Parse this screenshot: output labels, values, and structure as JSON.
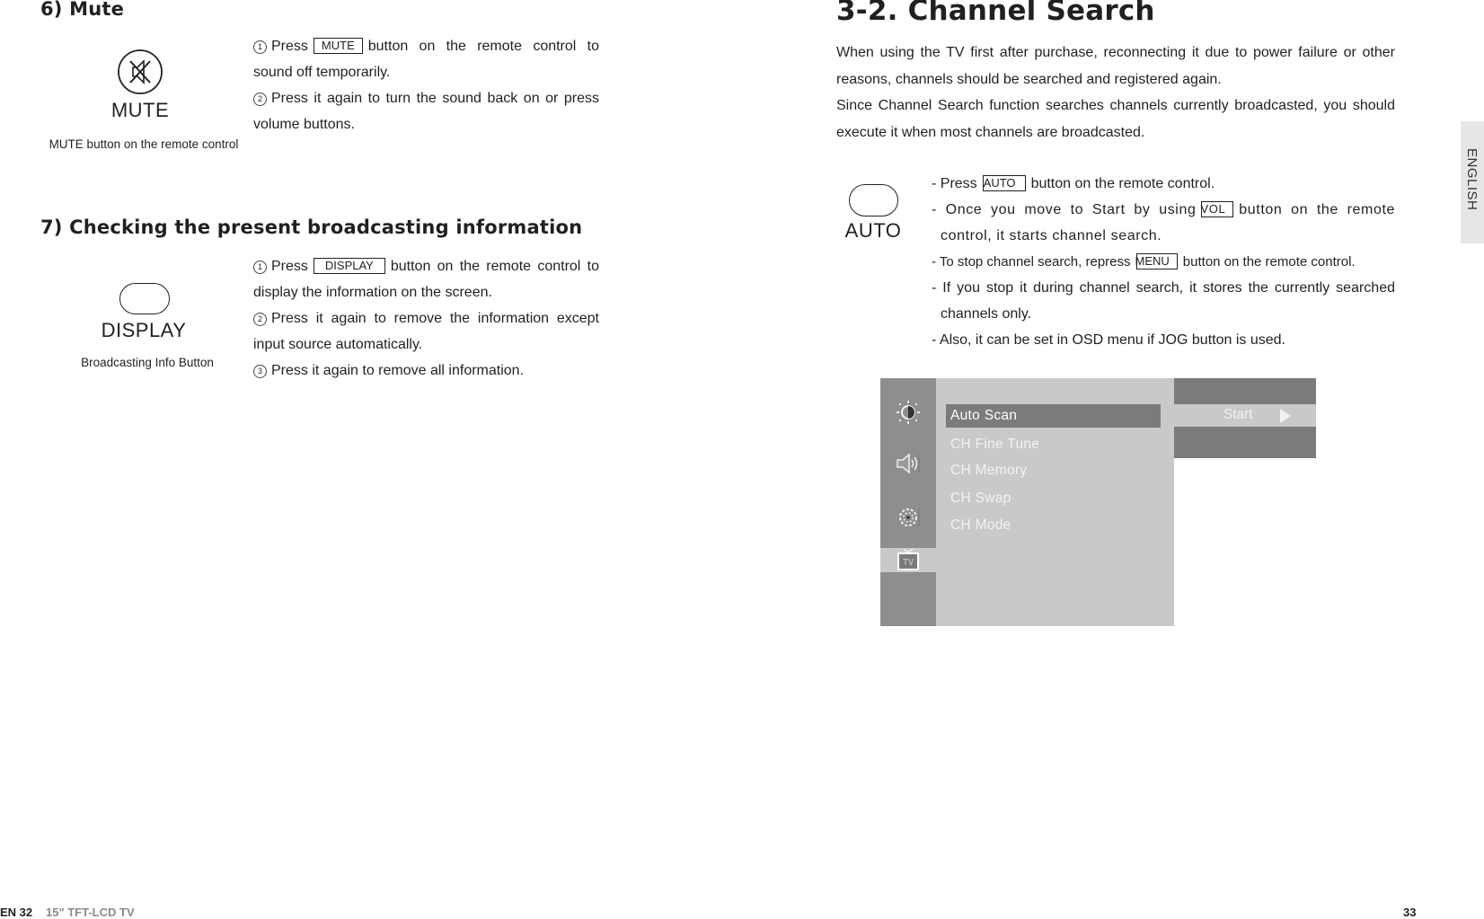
{
  "left_page": {
    "mute_section": {
      "heading": "6) Mute",
      "button_label": "MUTE",
      "caption": "MUTE button on the remote control",
      "steps": [
        {
          "num": "1",
          "pre": "Press",
          "key": "MUTE",
          "post": "button on the remote control to sound off temporarily."
        },
        {
          "num": "2",
          "text": "Press it again to turn the sound back on or press volume buttons."
        }
      ]
    },
    "display_section": {
      "heading": "7) Checking the present broadcasting information",
      "button_label": "DISPLAY",
      "caption": "Broadcasting Info Button",
      "steps": [
        {
          "num": "1",
          "pre": "Press",
          "key": "DISPLAY",
          "post": "button on the remote control to display the information on the screen."
        },
        {
          "num": "2",
          "text": "Press it again to remove the information except input source automatically."
        },
        {
          "num": "3",
          "text": "Press it again to remove all information."
        }
      ]
    },
    "footer": {
      "page": "EN 32",
      "product": "15\" TFT-LCD TV"
    }
  },
  "right_page": {
    "title": "3-2. Channel Search",
    "paragraphs": [
      "When using the TV first after purchase, reconnecting it due to power failure or other reasons, channels should be searched and registered again.",
      "Since Channel Search function searches channels currently broadcasted, you should execute it when most channels are broadcasted."
    ],
    "button_label": "AUTO",
    "bullets": [
      {
        "pre": "- Press",
        "key": "AUTO",
        "post": "button on the remote control."
      },
      {
        "pre": "- Once you move to Start by using",
        "key": "VOL",
        "post": "button on the remote control, it starts channel search."
      },
      {
        "pre": "- To stop channel search, repress",
        "key": "MENU",
        "post": "button on the remote control."
      },
      {
        "text": "- If you stop it during channel search, it stores the currently searched channels only."
      },
      {
        "text": "- Also, it can be set in OSD menu if JOG button is used."
      }
    ],
    "osd_menu": {
      "icons": [
        "picture-icon",
        "sound-icon",
        "setup-icon",
        "tv-icon"
      ],
      "selected_icon": "tv-icon",
      "items": [
        "Auto Scan",
        "CH Fine Tune",
        "CH Memory",
        "CH Swap",
        "CH Mode"
      ],
      "selected_item": "Auto Scan",
      "submenu_value": "Start"
    },
    "language_tab": "ENGLISH",
    "footer": {
      "page": "33"
    }
  }
}
